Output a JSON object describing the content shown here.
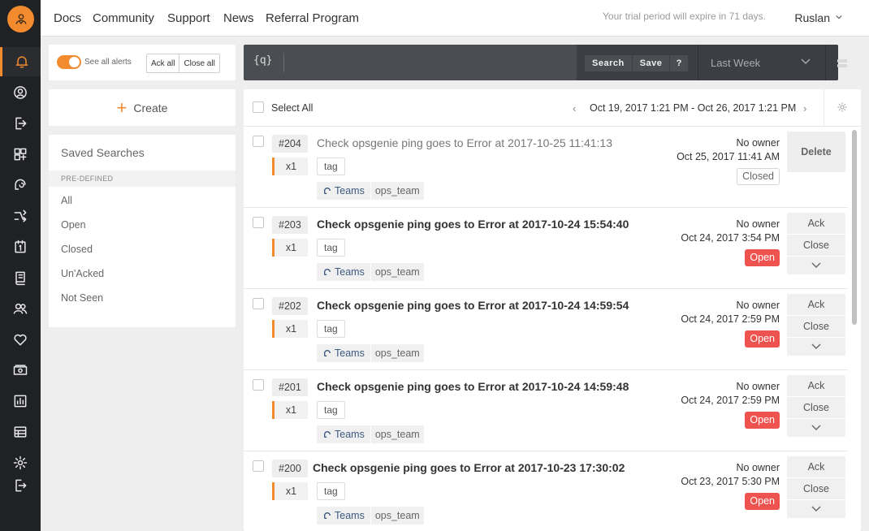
{
  "nav": {
    "links": [
      "Docs",
      "Community",
      "Support",
      "News",
      "Referral Program"
    ],
    "trial_notice": "Your trial period will expire in 71 days.",
    "user_name": "Ruslan"
  },
  "rail_icons": [
    "alerts-bell-icon",
    "profile-icon",
    "incidents-icon",
    "integrations-icon",
    "heartbeat-icon",
    "policies-icon",
    "schedules-icon",
    "services-icon",
    "teams-icon",
    "health-icon",
    "billing-icon",
    "reports-icon",
    "logs-icon",
    "settings-icon",
    "logout-icon"
  ],
  "alerts_ctrl": {
    "toggle_label": "See all alerts",
    "ack_all": "Ack all",
    "close_all": "Close all"
  },
  "create_label": "Create",
  "saved_searches": {
    "title": "Saved Searches",
    "section": "PRE-DEFINED",
    "items": [
      "All",
      "Open",
      "Closed",
      "Un'Acked",
      "Not Seen"
    ]
  },
  "search": {
    "query_icon": "{q}",
    "search_label": "Search",
    "save_label": "Save",
    "help_label": "?",
    "period": "Last Week"
  },
  "list": {
    "select_all": "Select All",
    "date_range": "Oct 19, 2017 1:21 PM - Oct 26, 2017 1:21 PM",
    "prev": "‹",
    "next": "›"
  },
  "colors": {
    "accent": "#f28b2e",
    "open_status": "#ef5350",
    "rail_bg": "#1f2124",
    "search_bg": "#4a4d51"
  },
  "alerts": [
    {
      "num": "#204",
      "message": "Check opsgenie ping goes to Error at 2017-10-25 11:41:13",
      "count": "x1",
      "tag": "tag",
      "teams_label": "Teams",
      "team": "ops_team",
      "owner": "No owner",
      "date": "Oct 25, 2017 11:41 AM",
      "status": "Closed",
      "action": "Delete"
    },
    {
      "num": "#203",
      "message": "Check opsgenie ping goes to Error at 2017-10-24 15:54:40",
      "count": "x1",
      "tag": "tag",
      "teams_label": "Teams",
      "team": "ops_team",
      "owner": "No owner",
      "date": "Oct 24, 2017 3:54 PM",
      "status": "Open",
      "ack": "Ack",
      "close": "Close"
    },
    {
      "num": "#202",
      "message": "Check opsgenie ping goes to Error at 2017-10-24 14:59:54",
      "count": "x1",
      "tag": "tag",
      "teams_label": "Teams",
      "team": "ops_team",
      "owner": "No owner",
      "date": "Oct 24, 2017 2:59 PM",
      "status": "Open",
      "ack": "Ack",
      "close": "Close"
    },
    {
      "num": "#201",
      "message": "Check opsgenie ping goes to Error at 2017-10-24 14:59:48",
      "count": "x1",
      "tag": "tag",
      "teams_label": "Teams",
      "team": "ops_team",
      "owner": "No owner",
      "date": "Oct 24, 2017 2:59 PM",
      "status": "Open",
      "ack": "Ack",
      "close": "Close"
    },
    {
      "num": "#200",
      "message": "Check opsgenie ping goes to Error at 2017-10-23 17:30:02",
      "count": "x1",
      "tag": "tag",
      "teams_label": "Teams",
      "team": "ops_team",
      "owner": "No owner",
      "date": "Oct 23, 2017 5:30 PM",
      "status": "Open",
      "ack": "Ack",
      "close": "Close"
    }
  ]
}
